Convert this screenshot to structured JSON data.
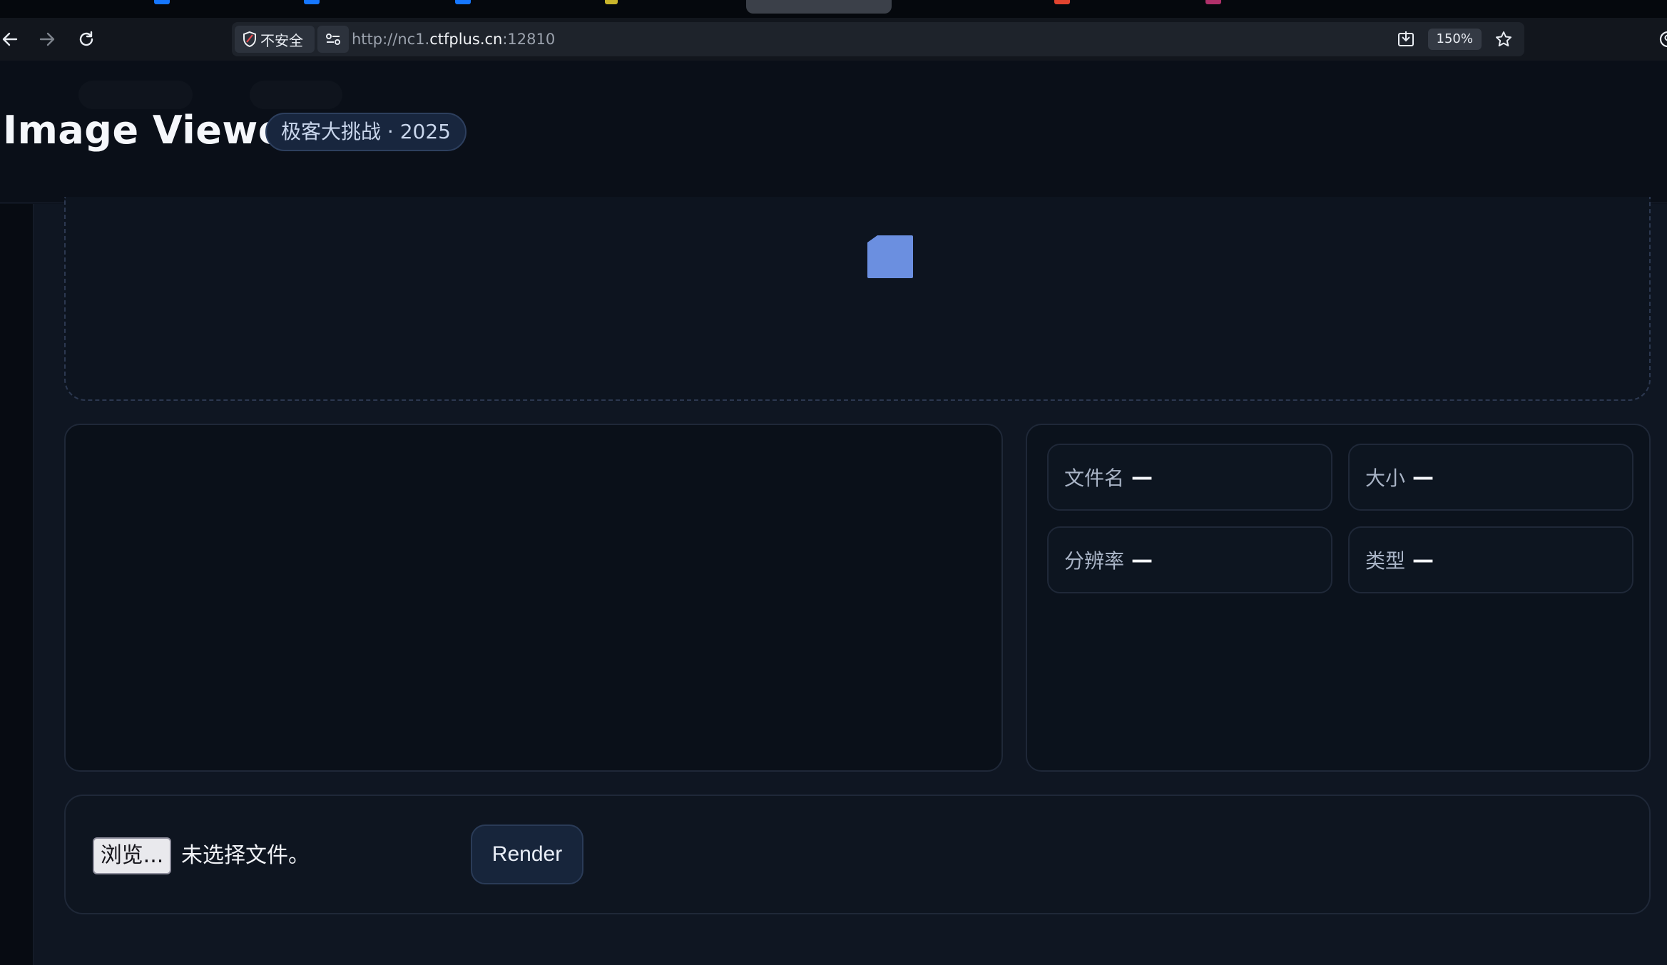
{
  "browser": {
    "security_label": "不安全",
    "url_scheme": "http://nc1.",
    "url_host": "ctfplus.cn",
    "url_port": ":12810",
    "zoom": "150%"
  },
  "header": {
    "title": "Image Viewer",
    "badge": "极客大挑战 · 2025"
  },
  "meta": {
    "filename_label": "文件名",
    "filename_value": "—",
    "size_label": "大小",
    "size_value": "—",
    "resolution_label": "分辨率",
    "resolution_value": "—",
    "type_label": "类型",
    "type_value": "—"
  },
  "controls": {
    "browse_label": "浏览...",
    "no_file_text": "未选择文件。",
    "render_label": "Render"
  },
  "colors": {
    "accent": "#6b8fe0",
    "background": "#0b111b"
  }
}
